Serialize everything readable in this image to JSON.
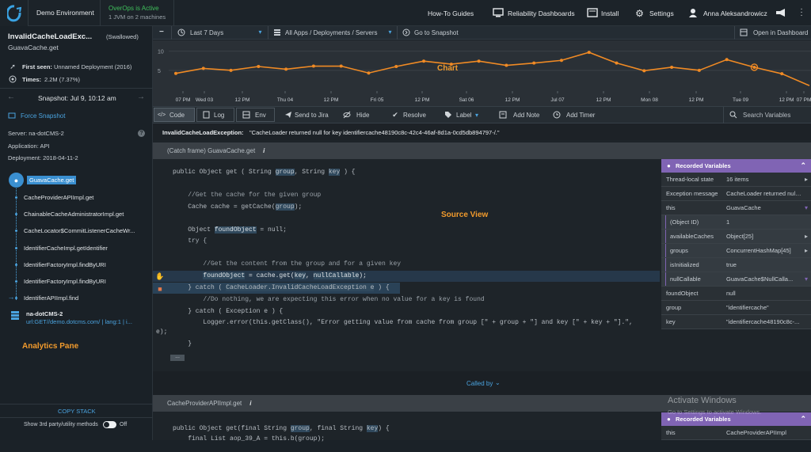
{
  "topbar": {
    "env": "Demo Environment",
    "status_line1": "OverOps is Active",
    "status_line2": "1 JVM on 2 machines",
    "howto": "How-To Guides",
    "reliability": "Reliability Dashboards",
    "install": "Install",
    "settings": "Settings",
    "user": "Anna Aleksandrowicz"
  },
  "left": {
    "title": "InvalidCacheLoadExc...",
    "swallowed": "(Swallowed)",
    "subtitle": "GuavaCache.get",
    "first_seen_label": "First seen:",
    "first_seen_value": "Unnamed Deployment (2016)",
    "times_label": "Times:",
    "times_value": "2.2M (7.37%)",
    "snapshot": "Snapshot: Jul 9, 10:12 am",
    "force": "Force Snapshot",
    "server": "Server: na-dotCMS-2",
    "application": "Application: API",
    "deployment": "Deployment: 2018-04-11-2",
    "stack": [
      "GuavaCache.get",
      "CacheProviderAPIImpl.get",
      "ChainableCacheAdministratorImpl.get",
      "CacheLocator$CommitListenerCacheWr...",
      "IdentifierCacheImpl.getIdentifier",
      "IdentifierFactoryImpl.findByURI",
      "IdentifierFactoryImpl.findByURI",
      "IdentifierAPIImpl.find"
    ],
    "server_node": "na-dotCMS-2",
    "server_url": "url:GET//demo.dotcms.com/ | lang:1 | i...",
    "analytics": "Analytics Pane",
    "copy_stack": "COPY STACK",
    "show_3rd": "Show 3rd party/utility methods",
    "off": "Off"
  },
  "filters": {
    "time": "Last 7 Days",
    "apps": "All Apps / Deployments / Servers",
    "goto": "Go to Snapshot",
    "open": "Open in Dashboard"
  },
  "chart_data": {
    "type": "line",
    "title": "Chart",
    "y_ticks": [
      "10",
      "5"
    ],
    "ylim": [
      0,
      12
    ],
    "x_ticks": [
      "07 PM",
      "Wed 03",
      "12 PM",
      "Thu 04",
      "12 PM",
      "Fri 05",
      "12 PM",
      "Sat 06",
      "12 PM",
      "Jul 07",
      "12 PM",
      "Mon 08",
      "12 PM",
      "Tue 09",
      "12 PM",
      "07 PM"
    ],
    "series": [
      {
        "values": [
          4.2,
          5.5,
          5.0,
          6.0,
          5.3,
          6.1,
          6.1,
          4.3,
          6.0,
          7.4,
          6.6,
          7.4,
          6.3,
          6.9,
          7.6,
          9.7,
          6.9,
          4.9,
          5.8,
          5.0,
          7.8,
          5.8,
          4.1,
          1.0
        ]
      }
    ],
    "color": "#f08a24"
  },
  "toolbar": {
    "code": "Code",
    "log": "Log",
    "env": "Env",
    "jira": "Send to Jira",
    "hide": "Hide",
    "resolve": "Resolve",
    "label": "Label",
    "note": "Add Note",
    "timer": "Add Timer",
    "search": "Search Variables"
  },
  "exception": {
    "name": "InvalidCacheLoadException:",
    "message": "\"CacheLoader returned null for key identifiercache48190c8c-42c4-46af-8d1a-0cd5db894797-/.\""
  },
  "source": {
    "frame": "(Catch frame) GuavaCache.get",
    "label": "Source View",
    "lines": [
      "public Object get ( String group, String key ) {",
      "",
      "    //Get the cache for the given group",
      "    Cache cache = getCache(group);",
      "",
      "    Object foundObject = null;",
      "    try {",
      "",
      "        //Get the content from the group and for a given key",
      "        foundObject = cache.get(key, nullCallable);",
      "    } catch ( CacheLoader.InvalidCacheLoadException e ) {",
      "        //Do nothing, we are expecting this error when no value for a key is found",
      "    } catch ( Exception e ) {",
      "        Logger.error(this.getClass(), \"Error getting value from cache from group [\" + group + \"] and key [\" + key + \"].\",",
      "e);",
      "    }"
    ],
    "ellipsis": "...",
    "called_by": "Called by",
    "frame2": "CacheProviderAPIImpl.get",
    "lines2": [
      "public Object get(final String group, final String key) {",
      "    final List aop_39_A = this.b(group);"
    ]
  },
  "variables": {
    "header": "Recorded Variables",
    "rows": [
      {
        "k": "Thread-local state",
        "v": "16 items"
      },
      {
        "k": "Exception message",
        "v": "CacheLoader returned null..."
      },
      {
        "k": "this",
        "v": "GuavaCache"
      },
      {
        "k": "(Object ID)",
        "v": "1"
      },
      {
        "k": "availableCaches",
        "v": "Object[25]"
      },
      {
        "k": "groups",
        "v": "ConcurrentHashMap[45]"
      },
      {
        "k": "isInitialized",
        "v": "true"
      },
      {
        "k": "nullCallable",
        "v": "GuavaCache$NullCalla..."
      },
      {
        "k": "foundObject",
        "v": "null"
      },
      {
        "k": "group",
        "v": "\"identifiercache\""
      },
      {
        "k": "key",
        "v": "\"identifiercache48190c8c-..."
      }
    ],
    "header2": "Recorded Variables",
    "row2_k": "this",
    "row2_v": "CacheProviderAPIImpl"
  },
  "watermark": {
    "line1": "Activate Windows",
    "line2": "Go to Settings to activate Windows."
  }
}
